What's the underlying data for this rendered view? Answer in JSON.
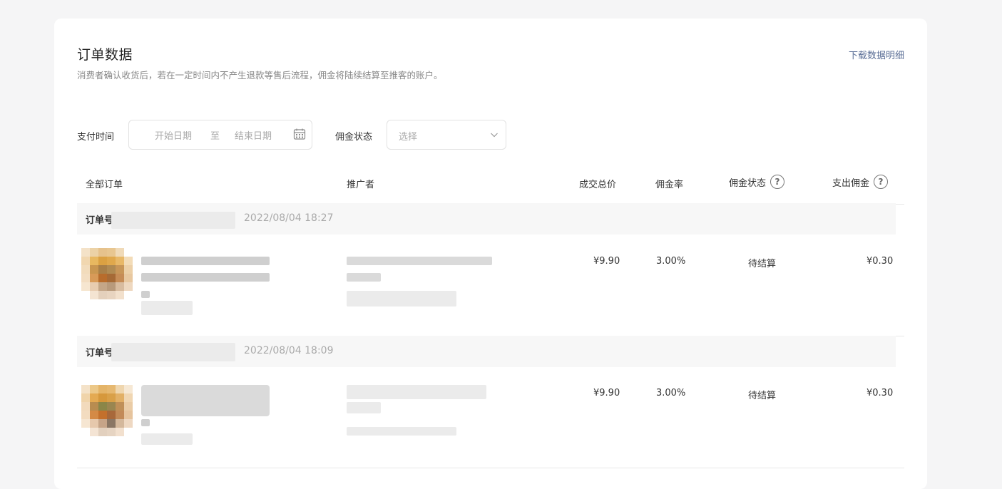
{
  "header": {
    "title": "订单数据",
    "subtitle": "消费者确认收货后，若在一定时间内不产生退款等售后流程，佣金将陆续结算至推客的账户。",
    "download_link": "下载数据明细"
  },
  "filters": {
    "pay_time_label": "支付时间",
    "start_placeholder": "开始日期",
    "separator": "至",
    "end_placeholder": "结束日期",
    "status_label": "佣金状态",
    "status_placeholder": "选择"
  },
  "table": {
    "columns": {
      "all_orders": "全部订单",
      "promoter": "推广者",
      "total_price": "成交总价",
      "commission_rate": "佣金率",
      "commission_status": "佣金状态",
      "payout": "支出佣金"
    },
    "help_glyph": "?",
    "orders": [
      {
        "label": "订单号",
        "time": "2022/08/04 18:27",
        "price": "¥9.90",
        "rate": "3.00%",
        "status": "待结算",
        "payout": "¥0.30"
      },
      {
        "label": "订单号",
        "time": "2022/08/04 18:09",
        "price": "¥9.90",
        "rate": "3.00%",
        "status": "待结算",
        "payout": "¥0.30"
      }
    ]
  },
  "icons": {
    "calendar": "calendar-icon",
    "chevron": "chevron-down-icon",
    "help": "help-circle-icon"
  },
  "colors": {
    "link": "#5a6e96",
    "placeholder": "#aaaaaa",
    "border": "#e2e2e2"
  }
}
